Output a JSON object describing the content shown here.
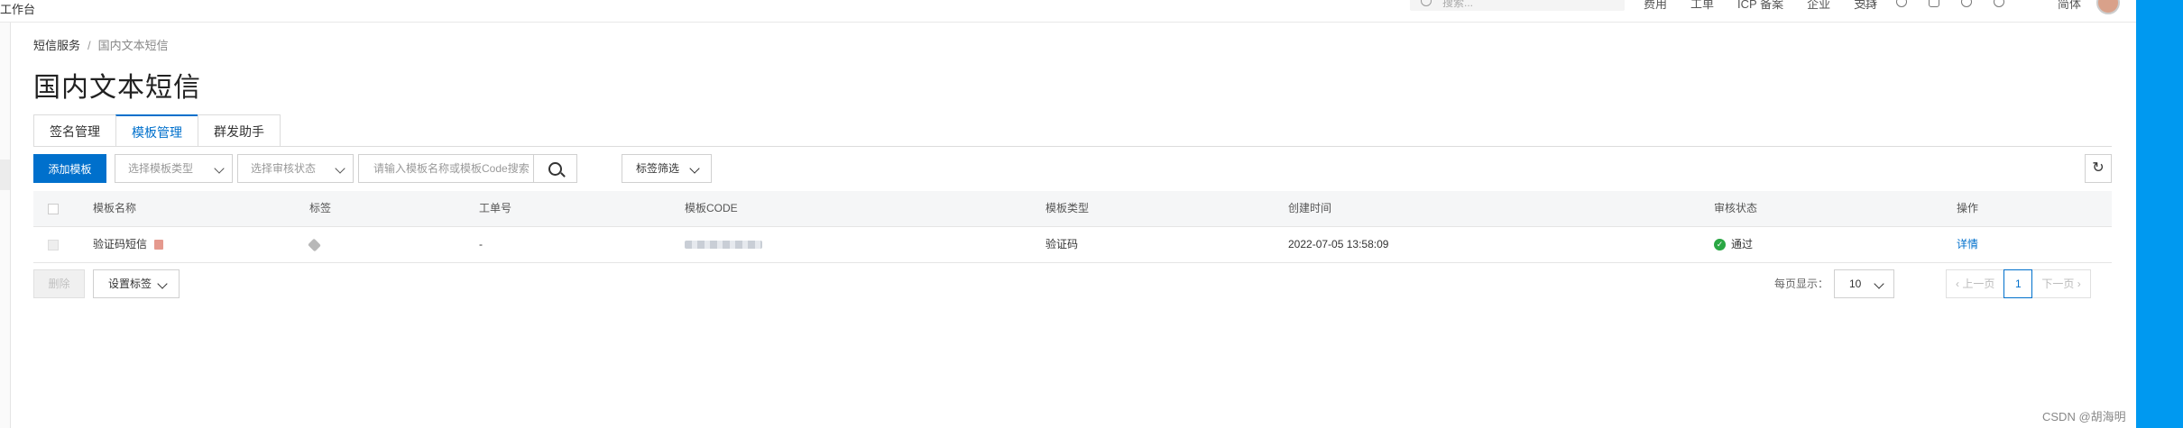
{
  "topbar": {
    "left_label": "工作台",
    "search_placeholder": "搜索...",
    "links": [
      "费用",
      "工单",
      "ICP 备案",
      "企业",
      "支持"
    ],
    "icons": [
      "message-icon",
      "cloud-icon",
      "cart-icon",
      "bulb-icon",
      "help-icon"
    ],
    "user_label": "简体"
  },
  "breadcrumb": {
    "root": "短信服务",
    "separator": "/",
    "current": "国内文本短信"
  },
  "page": {
    "title": "国内文本短信"
  },
  "tabs": [
    {
      "label": "签名管理",
      "active": false
    },
    {
      "label": "模板管理",
      "active": true
    },
    {
      "label": "群发助手",
      "active": false
    }
  ],
  "toolbar": {
    "add_label": "添加模板",
    "template_type_placeholder": "选择模板类型",
    "review_status_placeholder": "选择审核状态",
    "search_placeholder": "请输入模板名称或模板Code搜索",
    "tag_filter_label": "标签筛选"
  },
  "table": {
    "columns": [
      "模板名称",
      "标签",
      "工单号",
      "模板CODE",
      "模板类型",
      "创建时间",
      "审核状态",
      "操作"
    ],
    "rows": [
      {
        "name": "验证码短信",
        "tag": "",
        "ticket": "-",
        "code_masked": true,
        "type": "验证码",
        "created": "2022-07-05 13:58:09",
        "status": "通过",
        "action": "详情"
      }
    ]
  },
  "footer": {
    "delete_label": "删除",
    "set_tag_label": "设置标签",
    "page_size_label": "每页显示：",
    "page_size_value": "10",
    "prev_label": "上一页",
    "current_page": "1",
    "next_label": "下一页"
  },
  "watermark": "CSDN @胡海明",
  "colors": {
    "primary": "#0070cc",
    "success": "#2aa744",
    "right_panel": "#0099f0"
  }
}
